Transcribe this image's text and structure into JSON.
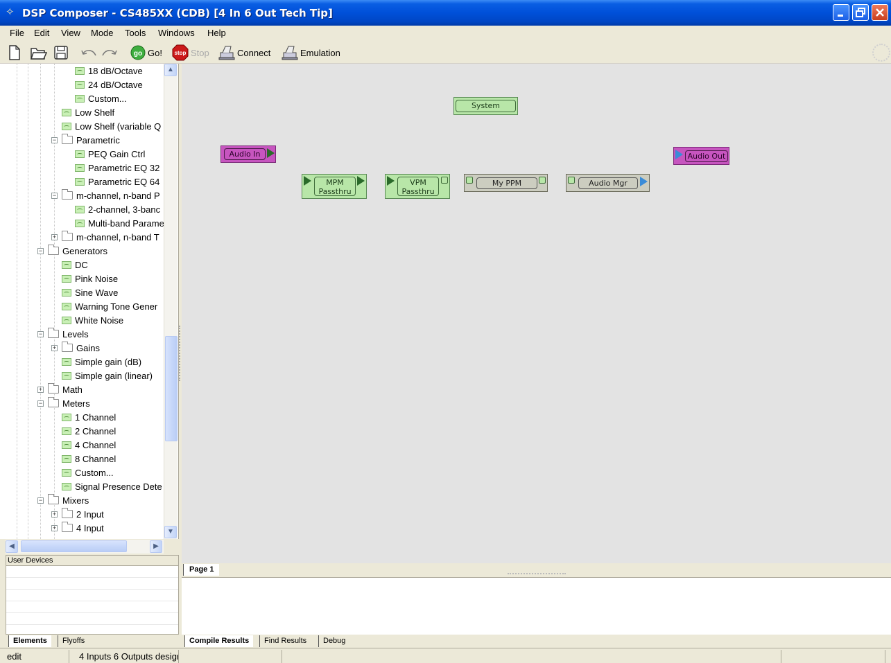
{
  "window": {
    "title": "DSP Composer - CS485XX (CDB) [4 In 6 Out Tech Tip]"
  },
  "menu": [
    "File",
    "Edit",
    "View",
    "Mode",
    "Tools",
    "Windows",
    "Help"
  ],
  "toolbar": {
    "go": "Go!",
    "stop": "Stop",
    "connect": "Connect",
    "emulation": "Emulation",
    "go_badge": "go",
    "stop_badge": "stop"
  },
  "tree": [
    {
      "label": "18 dB/Octave",
      "type": "leaf",
      "level": 4
    },
    {
      "label": "24 dB/Octave",
      "type": "leaf",
      "level": 4
    },
    {
      "label": "Custom...",
      "type": "leaf",
      "level": 4
    },
    {
      "label": "Low Shelf",
      "type": "leaf",
      "level": 3
    },
    {
      "label": "Low Shelf (variable Q",
      "type": "leaf",
      "level": 3
    },
    {
      "label": "Parametric",
      "type": "folder",
      "expanded": true,
      "level": 3
    },
    {
      "label": "PEQ Gain Ctrl",
      "type": "leaf",
      "level": 4
    },
    {
      "label": "Parametric EQ 32",
      "type": "leaf",
      "level": 4
    },
    {
      "label": "Parametric EQ 64",
      "type": "leaf",
      "level": 4
    },
    {
      "label": "m-channel, n-band P",
      "type": "folder",
      "expanded": true,
      "level": 3
    },
    {
      "label": "2-channel, 3-banc",
      "type": "leaf",
      "level": 4
    },
    {
      "label": "Multi-band Parame",
      "type": "leaf",
      "level": 4
    },
    {
      "label": "m-channel, n-band T",
      "type": "folder",
      "expanded": false,
      "level": 3
    },
    {
      "label": "Generators",
      "type": "folder",
      "expanded": true,
      "level": 2
    },
    {
      "label": "DC",
      "type": "leaf",
      "level": 3
    },
    {
      "label": "Pink Noise",
      "type": "leaf",
      "level": 3
    },
    {
      "label": "Sine Wave",
      "type": "leaf",
      "level": 3
    },
    {
      "label": "Warning Tone Gener",
      "type": "leaf",
      "level": 3
    },
    {
      "label": "White Noise",
      "type": "leaf",
      "level": 3
    },
    {
      "label": "Levels",
      "type": "folder",
      "expanded": true,
      "level": 2
    },
    {
      "label": "Gains",
      "type": "folder",
      "expanded": false,
      "level": 3
    },
    {
      "label": "Simple gain (dB)",
      "type": "leaf",
      "level": 3
    },
    {
      "label": "Simple gain (linear)",
      "type": "leaf",
      "level": 3
    },
    {
      "label": "Math",
      "type": "folder",
      "expanded": false,
      "level": 2
    },
    {
      "label": "Meters",
      "type": "folder",
      "expanded": true,
      "level": 2
    },
    {
      "label": "1 Channel",
      "type": "leaf",
      "level": 3
    },
    {
      "label": "2 Channel",
      "type": "leaf",
      "level": 3
    },
    {
      "label": "4 Channel",
      "type": "leaf",
      "level": 3
    },
    {
      "label": "8 Channel",
      "type": "leaf",
      "level": 3
    },
    {
      "label": "Custom...",
      "type": "leaf",
      "level": 3
    },
    {
      "label": "Signal Presence Dete",
      "type": "leaf",
      "level": 3
    },
    {
      "label": "Mixers",
      "type": "folder",
      "expanded": true,
      "level": 2
    },
    {
      "label": "2 Input",
      "type": "folder",
      "expanded": false,
      "level": 3
    },
    {
      "label": "4 Input",
      "type": "folder",
      "expanded": false,
      "level": 3
    }
  ],
  "user_devices": {
    "header": "User Devices"
  },
  "left_tabs": [
    "Elements",
    "Flyoffs"
  ],
  "canvas": {
    "blocks": {
      "system": "System",
      "audio_in": "Audio In",
      "audio_out": "Audio Out",
      "mpm": "MPM Passthru",
      "vpm": "VPM Passthru",
      "my_ppm": "My PPM",
      "audio_mgr": "Audio Mgr"
    },
    "colors": {
      "block_green": "#b8e6a8",
      "block_gray": "#cccdc0",
      "block_pink": "#c655bf",
      "pin_blue": "#3a8cd8"
    }
  },
  "page_tabs": [
    "Page 1"
  ],
  "output_tabs": [
    "Compile Results",
    "Find Results",
    "Debug"
  ],
  "status": {
    "mode": "edit",
    "description": "4 Inputs 6 Outputs desigr"
  }
}
